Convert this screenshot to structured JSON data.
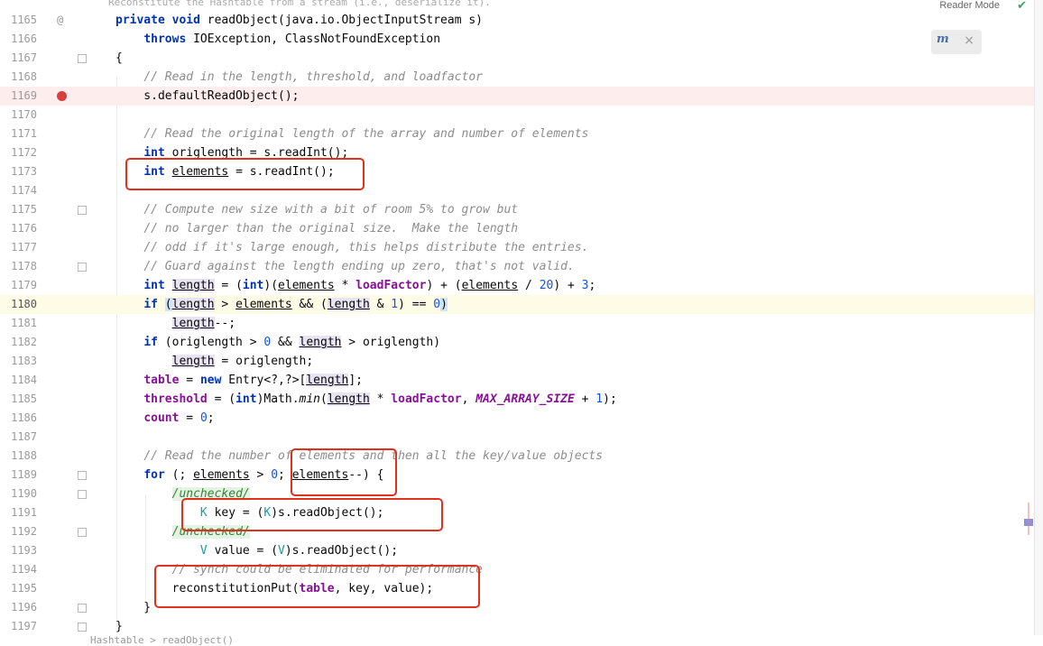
{
  "header": {
    "doc_hint": "Reconstitute the Hashtable from a stream (i.e., deserialize it).",
    "reader_mode": "Reader Mode",
    "check_icon": "check-icon",
    "inlay_icon": "m-inlay-icon",
    "inlay_letter": "m",
    "close_symbol": "×"
  },
  "footer": {
    "breadcrumb": "Hashtable  >  readObject()"
  },
  "colors": {
    "keyword": "#0033b3",
    "comment": "#8c8c8c",
    "number": "#1750eb",
    "field": "#871094",
    "type_param": "#20999d",
    "breakpoint": "#db3e3e",
    "breakpoint_line": "#fdeded",
    "current_line": "#fefbe6",
    "annotation_box": "#e0301e"
  },
  "gutter": {
    "override_marker": "@",
    "breakpoint_line": "1169"
  },
  "lines": [
    {
      "n": "1165",
      "t": "private void readObject(java.io.ObjectInputStream s)"
    },
    {
      "n": "1166",
      "t": "    throws IOException, ClassNotFoundException"
    },
    {
      "n": "1167",
      "t": "{"
    },
    {
      "n": "1168",
      "t": "    // Read in the length, threshold, and loadfactor"
    },
    {
      "n": "1169",
      "t": "    s.defaultReadObject();"
    },
    {
      "n": "1170",
      "t": ""
    },
    {
      "n": "1171",
      "t": "    // Read the original length of the array and number of elements"
    },
    {
      "n": "1172",
      "t": "    int origlength = s.readInt();"
    },
    {
      "n": "1173",
      "t": "    int elements = s.readInt();"
    },
    {
      "n": "1174",
      "t": ""
    },
    {
      "n": "1175",
      "t": "    // Compute new size with a bit of room 5% to grow but"
    },
    {
      "n": "1176",
      "t": "    // no larger than the original size.  Make the length"
    },
    {
      "n": "1177",
      "t": "    // odd if it's large enough, this helps distribute the entries."
    },
    {
      "n": "1178",
      "t": "    // Guard against the length ending up zero, that's not valid."
    },
    {
      "n": "1179",
      "t": "    int length = (int)(elements * loadFactor) + (elements / 20) + 3;"
    },
    {
      "n": "1180",
      "t": "    if (length > elements && (length & 1) == 0)"
    },
    {
      "n": "1181",
      "t": "        length--;"
    },
    {
      "n": "1182",
      "t": "    if (origlength > 0 && length > origlength)"
    },
    {
      "n": "1183",
      "t": "        length = origlength;"
    },
    {
      "n": "1184",
      "t": "    table = new Entry<?,?>[length];"
    },
    {
      "n": "1185",
      "t": "    threshold = (int)Math.min(length * loadFactor, MAX_ARRAY_SIZE + 1);"
    },
    {
      "n": "1186",
      "t": "    count = 0;"
    },
    {
      "n": "1187",
      "t": ""
    },
    {
      "n": "1188",
      "t": "    // Read the number of elements and then all the key/value objects"
    },
    {
      "n": "1189",
      "t": "    for (; elements > 0; elements--) {"
    },
    {
      "n": "1190",
      "t": "        /unchecked/"
    },
    {
      "n": "1191",
      "t": "            K key = (K)s.readObject();"
    },
    {
      "n": "1192",
      "t": "        /unchecked/"
    },
    {
      "n": "1193",
      "t": "            V value = (V)s.readObject();"
    },
    {
      "n": "1194",
      "t": "        // synch could be eliminated for performance"
    },
    {
      "n": "1195",
      "t": "        reconstitutionPut(table, key, value);"
    },
    {
      "n": "1196",
      "t": "    }"
    },
    {
      "n": "1197",
      "t": "}"
    }
  ]
}
